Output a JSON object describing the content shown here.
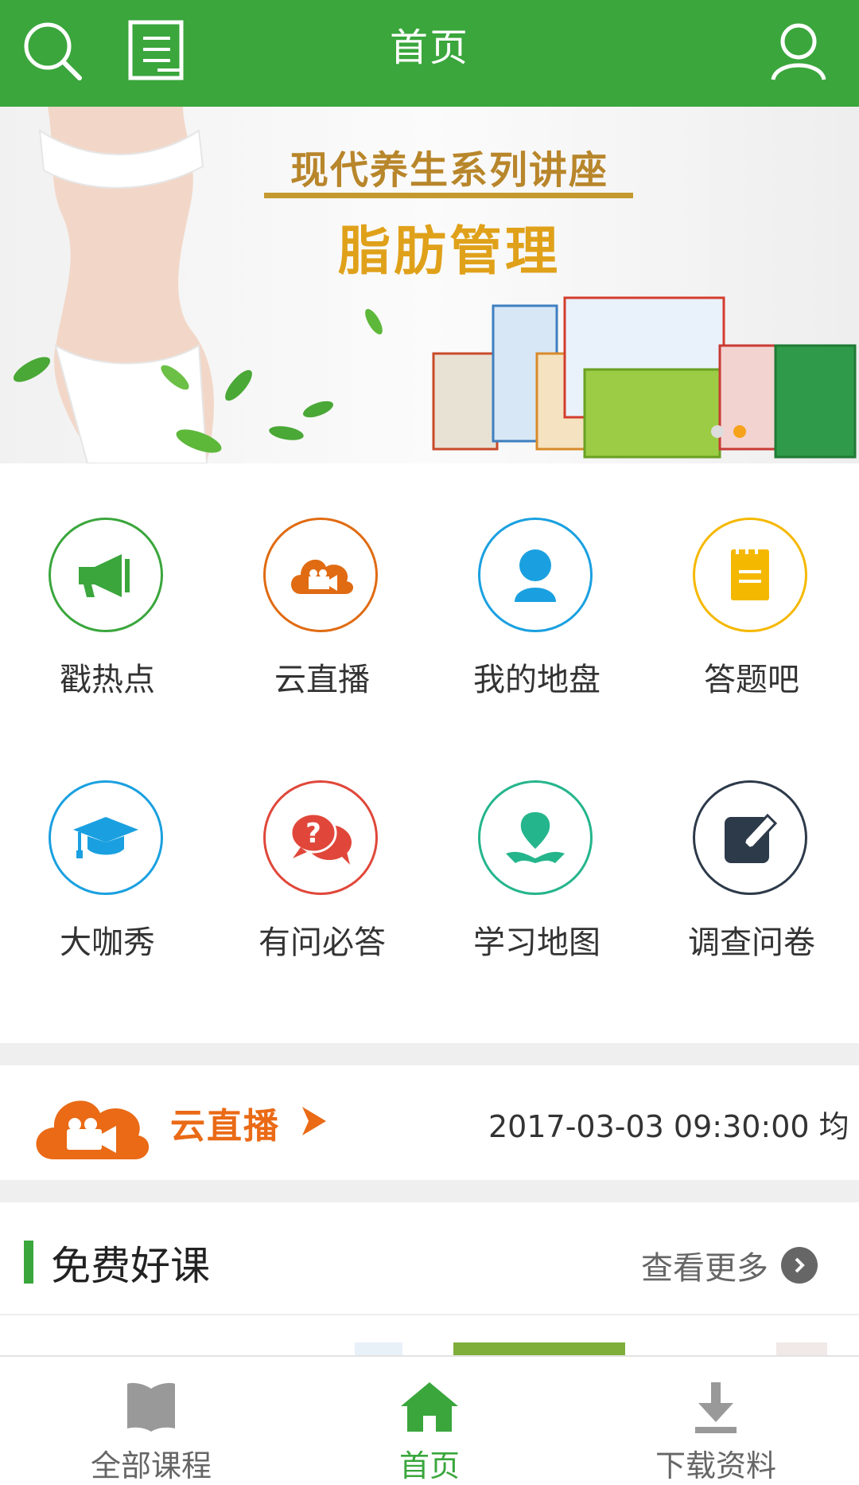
{
  "header": {
    "title": "首页",
    "left_icons": [
      "search-icon",
      "list-icon"
    ],
    "right_icon": "user-icon"
  },
  "banner": {
    "headline": "现代养生系列讲座",
    "subheadline": "脂肪管理",
    "pager": {
      "count": 2,
      "active_index": 1
    }
  },
  "features": [
    {
      "label": "戳热点",
      "icon": "megaphone-icon",
      "color": "#3aa63c"
    },
    {
      "label": "云直播",
      "icon": "video-cloud-icon",
      "color": "#e06b12"
    },
    {
      "label": "我的地盘",
      "icon": "person-icon",
      "color": "#1aa0e0"
    },
    {
      "label": "答题吧",
      "icon": "notepad-icon",
      "color": "#f5b800"
    },
    {
      "label": "大咖秀",
      "icon": "graduation-cap-icon",
      "color": "#1aa0e0"
    },
    {
      "label": "有问必答",
      "icon": "question-bubble-icon",
      "color": "#e0473a"
    },
    {
      "label": "学习地图",
      "icon": "map-pin-icon",
      "color": "#25b58c"
    },
    {
      "label": "调查问卷",
      "icon": "edit-icon",
      "color": "#2d3a4a"
    }
  ],
  "live": {
    "label": "云直播",
    "schedule_text": "2017-03-03 09:30:00 均"
  },
  "free_courses": {
    "title": "免费好课",
    "more_label": "查看更多"
  },
  "tabbar": {
    "items": [
      {
        "label": "全部课程",
        "icon": "book-icon",
        "active": false
      },
      {
        "label": "首页",
        "icon": "home-icon",
        "active": true
      },
      {
        "label": "下载资料",
        "icon": "download-icon",
        "active": false
      }
    ]
  },
  "colors": {
    "brand_green": "#3aa63c",
    "live_orange": "#ea6a16"
  }
}
